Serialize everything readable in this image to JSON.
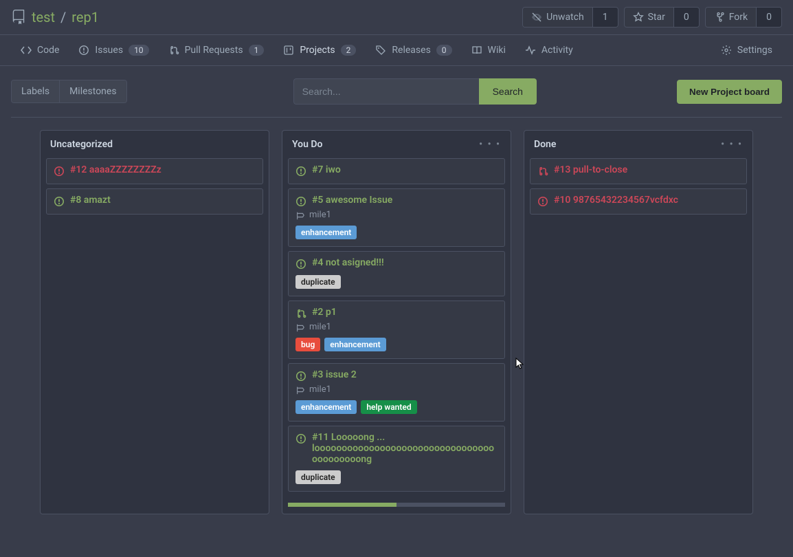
{
  "header": {
    "owner": "test",
    "repo": "rep1",
    "actions": {
      "unwatch": {
        "label": "Unwatch",
        "count": "1"
      },
      "star": {
        "label": "Star",
        "count": "0"
      },
      "fork": {
        "label": "Fork",
        "count": "0"
      }
    }
  },
  "tabs": {
    "code": "Code",
    "issues": {
      "label": "Issues",
      "count": "10"
    },
    "pulls": {
      "label": "Pull Requests",
      "count": "1"
    },
    "projects": {
      "label": "Projects",
      "count": "2"
    },
    "releases": {
      "label": "Releases",
      "count": "0"
    },
    "wiki": "Wiki",
    "activity": "Activity",
    "settings": "Settings"
  },
  "toolbar": {
    "labels": "Labels",
    "milestones": "Milestones",
    "search_placeholder": "Search...",
    "search_button": "Search",
    "new_board": "New Project board"
  },
  "columns": [
    {
      "title": "Uncategorized",
      "has_menu": false,
      "has_progress": false,
      "cards": [
        {
          "type": "issue-closed",
          "title": "#12 aaaaZZZZZZZZz"
        },
        {
          "type": "issue-open",
          "title": "#8 amazt"
        }
      ]
    },
    {
      "title": "You Do",
      "has_menu": true,
      "has_progress": true,
      "progress_done_pct": 50,
      "cards": [
        {
          "type": "issue-open",
          "title": "#7 iwo"
        },
        {
          "type": "issue-open",
          "title": "#5 awesome Issue",
          "milestone": "mile1",
          "labels": [
            "enhancement"
          ]
        },
        {
          "type": "issue-open",
          "title": "#4 not asigned!!!",
          "labels": [
            "duplicate"
          ]
        },
        {
          "type": "pr-open",
          "title": "#2 p1",
          "milestone": "mile1",
          "labels": [
            "bug",
            "enhancement"
          ]
        },
        {
          "type": "issue-open",
          "title": "#3 issue 2",
          "milestone": "mile1",
          "labels": [
            "enhancement",
            "help wanted"
          ]
        },
        {
          "type": "issue-open",
          "title": "#11 Looooong ... loooooooooooooooooooooooooooooooooooooooooong",
          "labels": [
            "duplicate"
          ]
        }
      ]
    },
    {
      "title": "Done",
      "has_menu": true,
      "has_progress": false,
      "cards": [
        {
          "type": "pr-closed",
          "title": "#13 pull-to-close"
        },
        {
          "type": "issue-closed",
          "title": "#10 98765432234567vcfdxc"
        }
      ]
    }
  ]
}
